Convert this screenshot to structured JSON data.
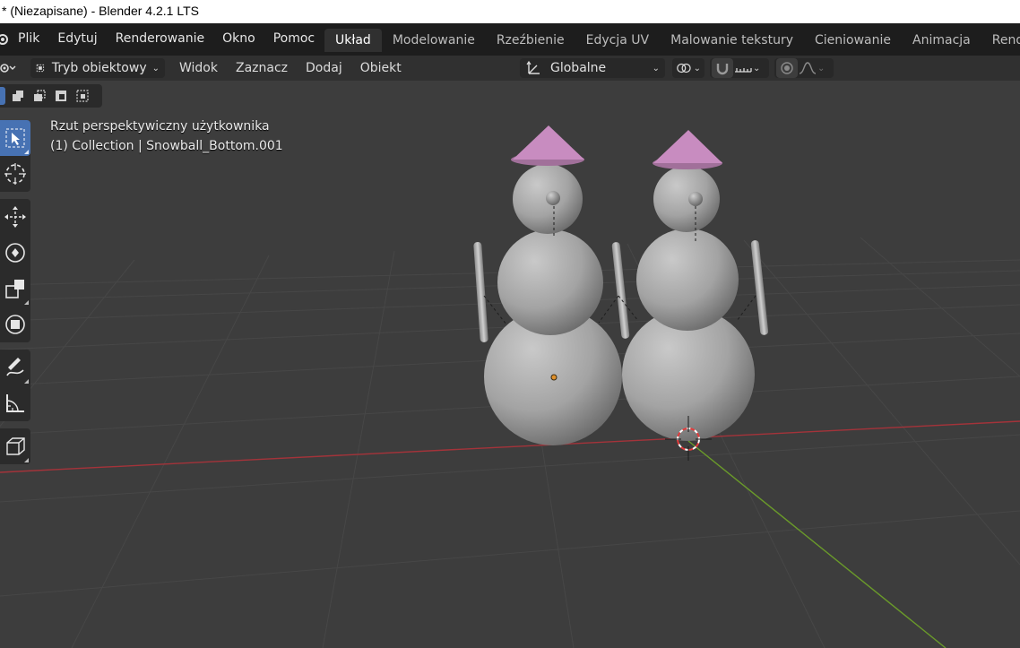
{
  "window": {
    "title": "* (Niezapisane) - Blender 4.2.1 LTS"
  },
  "menu": {
    "items": [
      "Plik",
      "Edytuj",
      "Renderowanie",
      "Okno",
      "Pomoc"
    ],
    "workspaces": [
      "Układ",
      "Modelowanie",
      "Rzeźbienie",
      "Edycja UV",
      "Malowanie tekstury",
      "Cieniowanie",
      "Animacja",
      "Renderow"
    ],
    "active_workspace": "Układ"
  },
  "header": {
    "mode_label": "Tryb obiektowy",
    "view_menu": [
      "Widok",
      "Zaznacz",
      "Dodaj",
      "Obiekt"
    ],
    "transform_orientation": "Globalne"
  },
  "viewport": {
    "view_name": "Rzut perspektywiczny użytkownika",
    "collection_info": "(1) Collection | Snowball_Bottom.001"
  },
  "tools": {
    "items": [
      {
        "name": "select-box-tool",
        "icon": "cursor-select-icon",
        "active": true
      },
      {
        "name": "cursor-tool",
        "icon": "3d-cursor-icon"
      },
      {
        "name": "move-tool",
        "icon": "move-arrows-icon"
      },
      {
        "name": "rotate-tool",
        "icon": "rotate-icon"
      },
      {
        "name": "scale-tool",
        "icon": "scale-icon"
      },
      {
        "name": "transform-tool",
        "icon": "transform-icon"
      },
      {
        "name": "annotate-tool",
        "icon": "pencil-icon"
      },
      {
        "name": "measure-tool",
        "icon": "ruler-icon"
      },
      {
        "name": "add-cube-tool",
        "icon": "cube-icon"
      }
    ]
  },
  "colors": {
    "active_blue": "#4772b3",
    "viewport_bg": "#3d3d3d",
    "grid_line": "#474747",
    "axis_x": "#a4333a",
    "axis_y": "#6a9a2a",
    "hat_pink": "#c88cc0",
    "snow_gray": "#a6a6a6"
  }
}
